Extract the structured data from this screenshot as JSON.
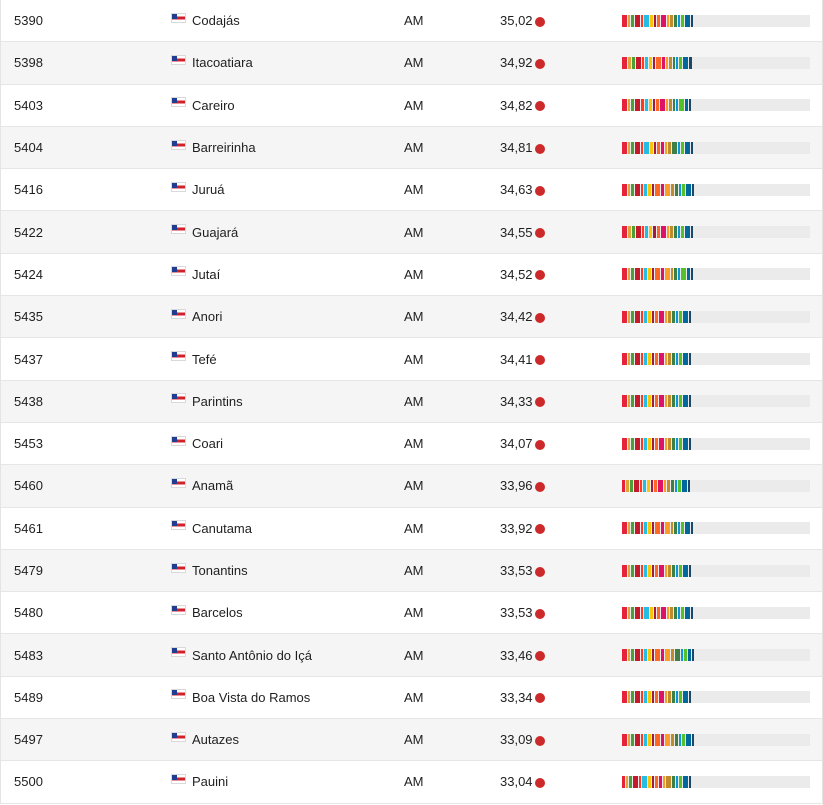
{
  "palette": {
    "sdg_colors": [
      "#e5243b",
      "#dda63a",
      "#4c9f38",
      "#c5192d",
      "#ff3a21",
      "#26bde2",
      "#fcc30b",
      "#a21942",
      "#fd6925",
      "#dd1367",
      "#fd9d24",
      "#bf8b2e",
      "#3f7e44",
      "#0a97d9",
      "#56c02b",
      "#00689d",
      "#19486a"
    ],
    "status_dot": "#cc2a2a"
  },
  "rows": [
    {
      "rank": "5390",
      "city": "Codajás",
      "state": "AM",
      "score": "35,02",
      "sdg_levels": [
        3,
        1,
        2,
        3,
        1,
        3,
        2,
        1,
        2,
        3,
        1,
        2,
        2,
        1,
        2,
        3,
        1
      ]
    },
    {
      "rank": "5398",
      "city": "Itacoatiara",
      "state": "AM",
      "score": "34,92",
      "sdg_levels": [
        3,
        2,
        2,
        3,
        1,
        2,
        2,
        1,
        3,
        2,
        1,
        2,
        1,
        1,
        2,
        3,
        2
      ]
    },
    {
      "rank": "5403",
      "city": "Careiro",
      "state": "AM",
      "score": "34,82",
      "sdg_levels": [
        3,
        1,
        2,
        3,
        2,
        2,
        2,
        1,
        2,
        3,
        1,
        2,
        1,
        1,
        3,
        2,
        1
      ]
    },
    {
      "rank": "5404",
      "city": "Barreirinha",
      "state": "AM",
      "score": "34,81",
      "sdg_levels": [
        3,
        1,
        2,
        3,
        1,
        3,
        2,
        1,
        2,
        2,
        1,
        2,
        3,
        1,
        2,
        3,
        1
      ]
    },
    {
      "rank": "5416",
      "city": "Juruá",
      "state": "AM",
      "score": "34,63",
      "sdg_levels": [
        3,
        1,
        2,
        3,
        1,
        2,
        2,
        1,
        3,
        2,
        3,
        2,
        2,
        1,
        2,
        3,
        1
      ]
    },
    {
      "rank": "5422",
      "city": "Guajará",
      "state": "AM",
      "score": "34,55",
      "sdg_levels": [
        3,
        2,
        2,
        3,
        1,
        2,
        2,
        2,
        2,
        3,
        1,
        2,
        2,
        1,
        2,
        3,
        1
      ]
    },
    {
      "rank": "5424",
      "city": "Jutaí",
      "state": "AM",
      "score": "34,52",
      "sdg_levels": [
        3,
        1,
        2,
        3,
        1,
        2,
        2,
        1,
        3,
        2,
        3,
        1,
        2,
        1,
        3,
        2,
        1
      ]
    },
    {
      "rank": "5435",
      "city": "Anori",
      "state": "AM",
      "score": "34,42",
      "sdg_levels": [
        3,
        1,
        2,
        3,
        1,
        2,
        2,
        1,
        2,
        3,
        1,
        2,
        2,
        1,
        2,
        3,
        1
      ]
    },
    {
      "rank": "5437",
      "city": "Tefé",
      "state": "AM",
      "score": "34,41",
      "sdg_levels": [
        3,
        1,
        2,
        3,
        1,
        2,
        2,
        1,
        2,
        3,
        1,
        2,
        2,
        1,
        2,
        3,
        1
      ]
    },
    {
      "rank": "5438",
      "city": "Parintins",
      "state": "AM",
      "score": "34,33",
      "sdg_levels": [
        3,
        1,
        2,
        3,
        1,
        2,
        2,
        1,
        2,
        3,
        1,
        2,
        2,
        1,
        2,
        3,
        1
      ]
    },
    {
      "rank": "5453",
      "city": "Coari",
      "state": "AM",
      "score": "34,07",
      "sdg_levels": [
        3,
        1,
        2,
        3,
        1,
        2,
        2,
        1,
        2,
        3,
        1,
        2,
        2,
        1,
        2,
        3,
        1
      ]
    },
    {
      "rank": "5460",
      "city": "Anamã",
      "state": "AM",
      "score": "33,96",
      "sdg_levels": [
        2,
        2,
        2,
        3,
        1,
        2,
        2,
        1,
        2,
        3,
        1,
        2,
        2,
        1,
        2,
        3,
        1
      ]
    },
    {
      "rank": "5461",
      "city": "Canutama",
      "state": "AM",
      "score": "33,92",
      "sdg_levels": [
        3,
        1,
        2,
        3,
        1,
        2,
        2,
        1,
        3,
        2,
        3,
        1,
        2,
        1,
        2,
        3,
        1
      ]
    },
    {
      "rank": "5479",
      "city": "Tonantins",
      "state": "AM",
      "score": "33,53",
      "sdg_levels": [
        3,
        1,
        2,
        3,
        1,
        2,
        2,
        1,
        2,
        3,
        1,
        2,
        2,
        1,
        2,
        3,
        1
      ]
    },
    {
      "rank": "5480",
      "city": "Barcelos",
      "state": "AM",
      "score": "33,53",
      "sdg_levels": [
        3,
        1,
        2,
        3,
        1,
        3,
        2,
        1,
        2,
        3,
        1,
        2,
        2,
        1,
        2,
        3,
        1
      ]
    },
    {
      "rank": "5483",
      "city": "Santo Antônio do Içá",
      "state": "AM",
      "score": "33,46",
      "sdg_levels": [
        3,
        1,
        2,
        3,
        1,
        2,
        2,
        1,
        3,
        2,
        3,
        2,
        3,
        1,
        2,
        2,
        1
      ]
    },
    {
      "rank": "5489",
      "city": "Boa Vista do Ramos",
      "state": "AM",
      "score": "33,34",
      "sdg_levels": [
        3,
        1,
        2,
        3,
        1,
        2,
        2,
        1,
        2,
        3,
        1,
        2,
        2,
        1,
        2,
        3,
        1
      ]
    },
    {
      "rank": "5497",
      "city": "Autazes",
      "state": "AM",
      "score": "33,09",
      "sdg_levels": [
        3,
        1,
        2,
        3,
        1,
        2,
        2,
        1,
        3,
        2,
        3,
        2,
        2,
        1,
        2,
        3,
        1
      ]
    },
    {
      "rank": "5500",
      "city": "Pauini",
      "state": "AM",
      "score": "33,04",
      "sdg_levels": [
        2,
        1,
        2,
        3,
        1,
        3,
        2,
        1,
        2,
        2,
        1,
        3,
        2,
        1,
        2,
        3,
        1
      ]
    }
  ]
}
